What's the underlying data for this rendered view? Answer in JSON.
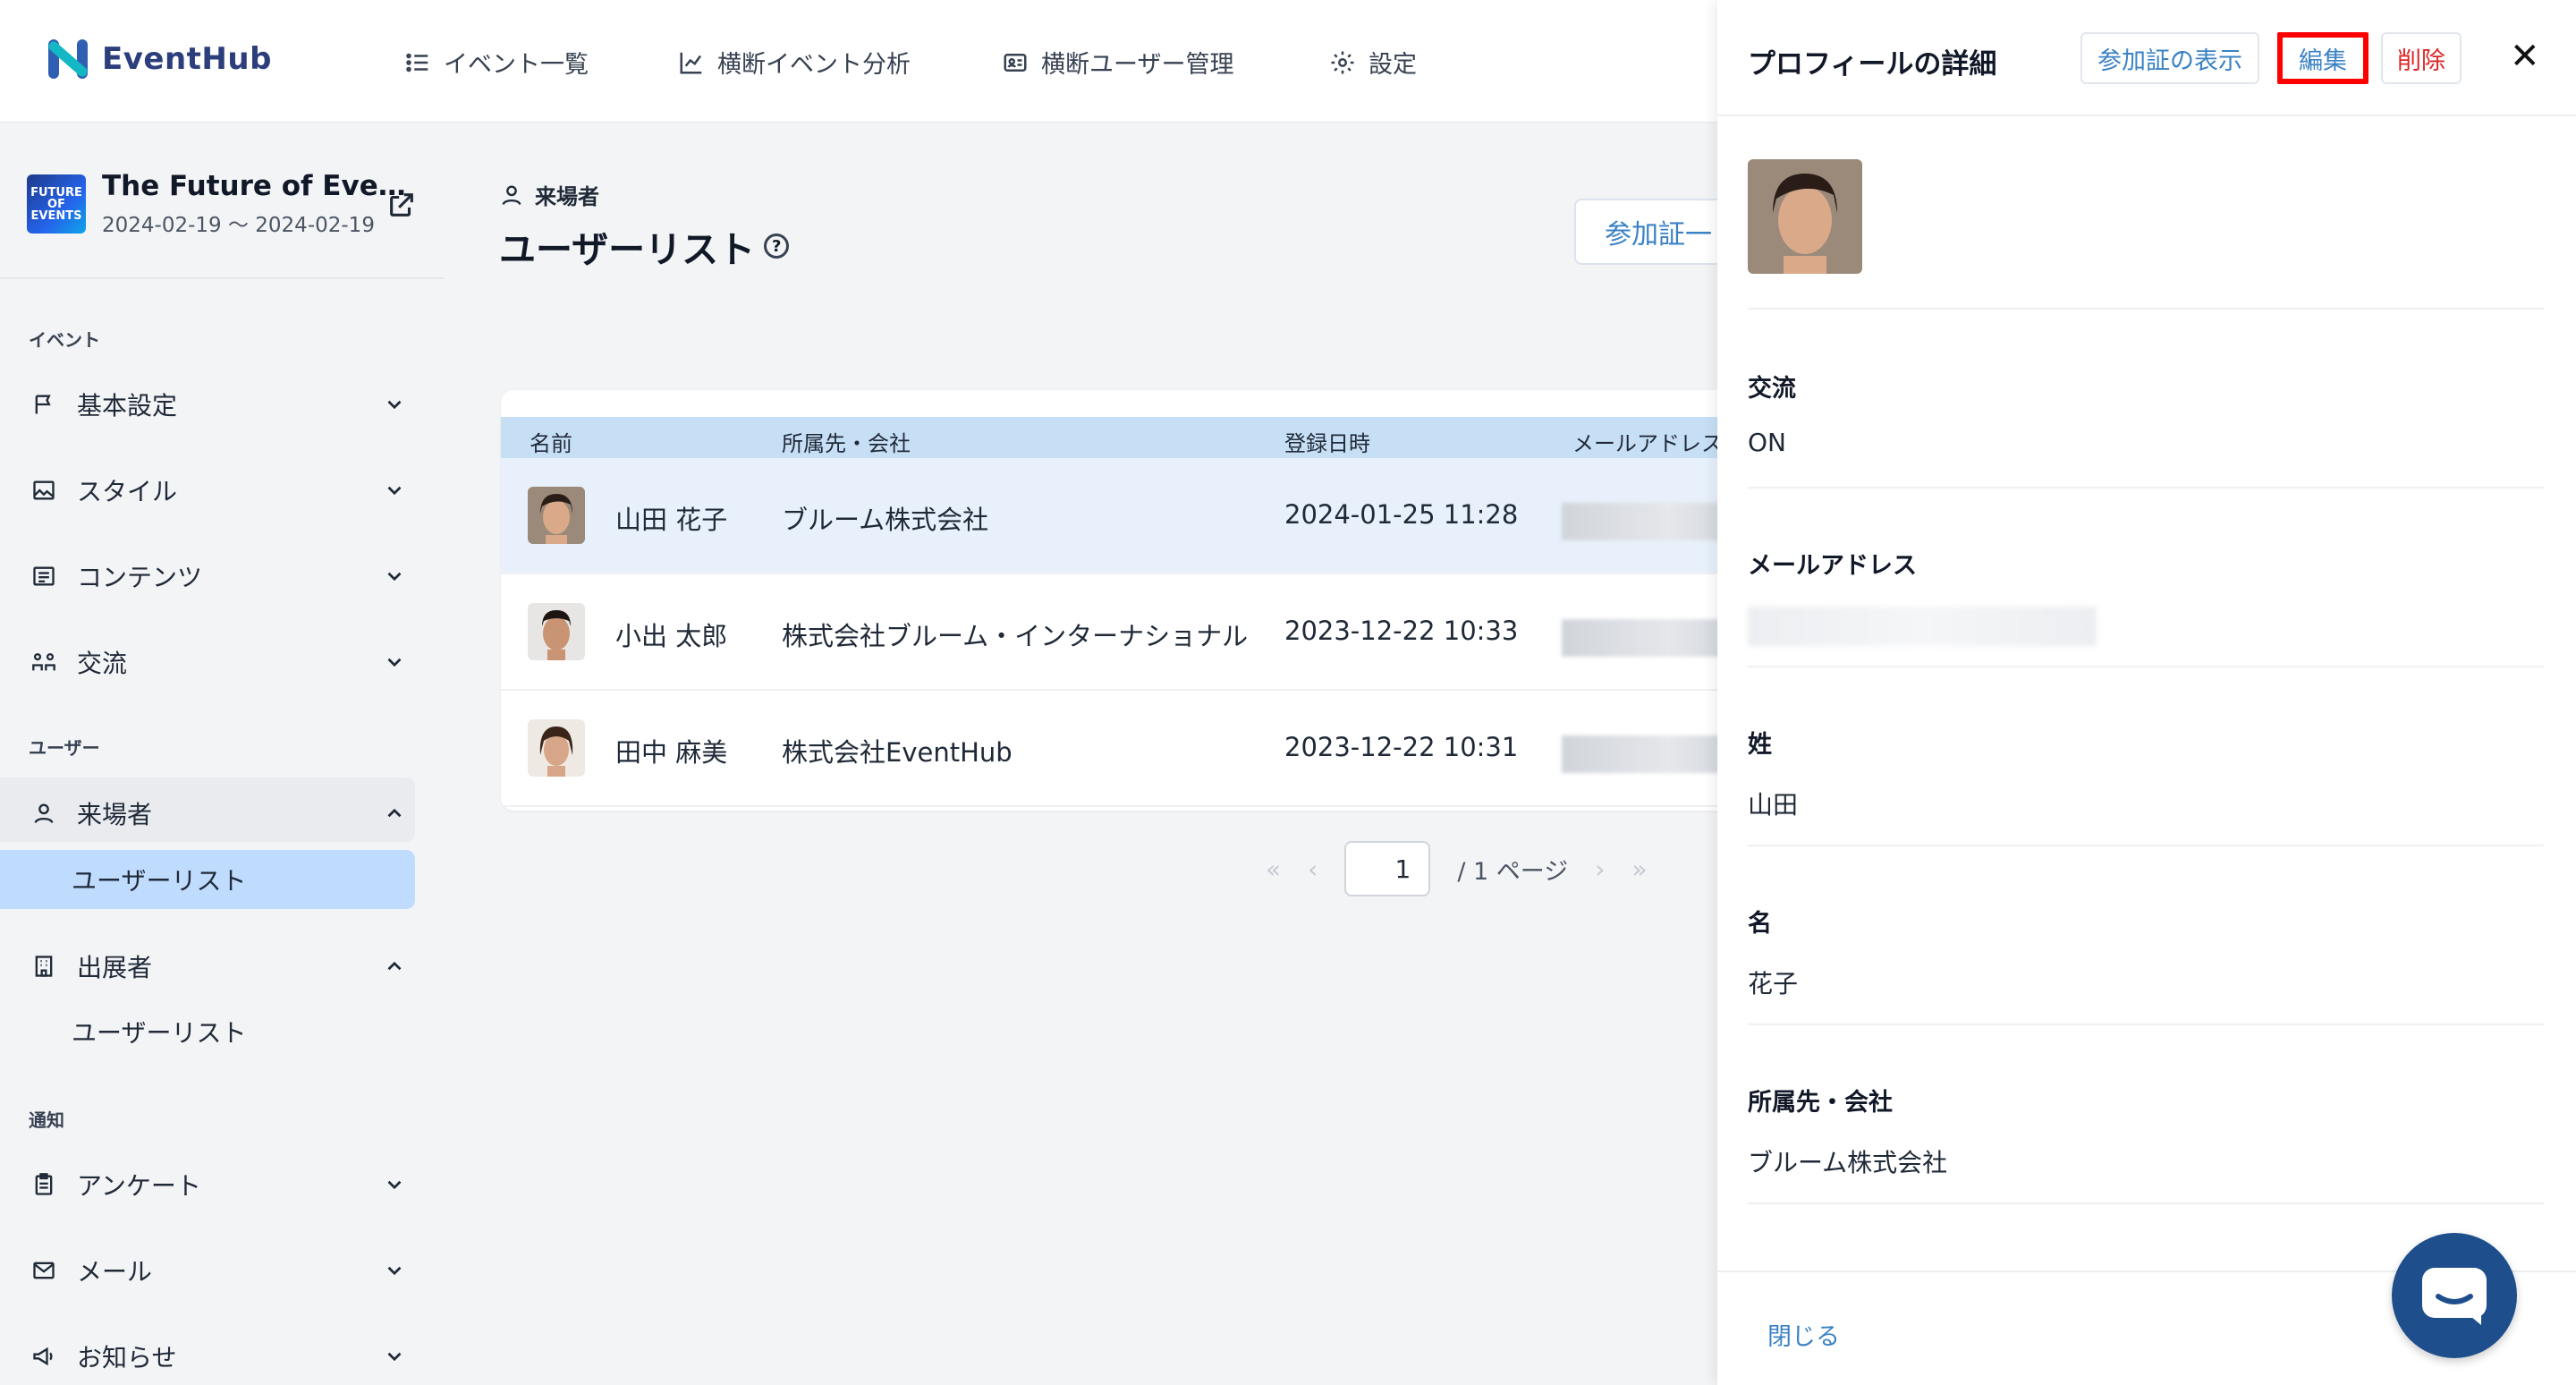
{
  "app": {
    "name": "EventHub",
    "nav": [
      "イベント一覧",
      "横断イベント分析",
      "横断ユーザー管理",
      "設定"
    ]
  },
  "event": {
    "title": "The Future of Eve…",
    "dates": "2024-02-19 〜 2024-02-19",
    "thumb_text": "FUTURE OF EVENTS"
  },
  "sidebar": {
    "section_event": "イベント",
    "section_user": "ユーザー",
    "section_notify": "通知",
    "items": {
      "basic": "基本設定",
      "style": "スタイル",
      "contents": "コンテンツ",
      "exchange": "交流",
      "visitors": "来場者",
      "visitors_userlist": "ユーザーリスト",
      "exhibitors": "出展者",
      "exhibitors_userlist": "ユーザーリスト",
      "survey": "アンケート",
      "mail": "メール",
      "news": "お知らせ"
    }
  },
  "main": {
    "breadcrumb": "来場者",
    "title": "ユーザーリスト",
    "help": "?",
    "pass_button": "参加証一",
    "columns": [
      "名前",
      "所属先・会社",
      "登録日時",
      "メールアドレス"
    ],
    "rows": [
      {
        "name": "山田 花子",
        "company": "ブルーム株式会社",
        "registered": "2024-01-25 11:28"
      },
      {
        "name": "小出 太郎",
        "company": "株式会社ブルーム・インターナショナル",
        "registered": "2023-12-22 10:33"
      },
      {
        "name": "田中 麻美",
        "company": "株式会社EventHub",
        "registered": "2023-12-22 10:31"
      }
    ],
    "pager": {
      "current": "1",
      "total_text": "/ 1 ページ"
    }
  },
  "drawer": {
    "title": "プロフィールの詳細",
    "show_pass": "参加証の表示",
    "edit": "編集",
    "delete": "削除",
    "close_x": "✕",
    "fields": [
      {
        "label": "交流",
        "value": "ON"
      },
      {
        "label": "メールアドレス",
        "value": ""
      },
      {
        "label": "姓",
        "value": "山田"
      },
      {
        "label": "名",
        "value": "花子"
      },
      {
        "label": "所属先・会社",
        "value": "ブルーム株式会社"
      }
    ],
    "close_link": "閉じる"
  },
  "colors": {
    "brand": "#2c3e7c",
    "link": "#3b82c4",
    "danger": "#dc2626",
    "highlight": "#ff0000",
    "active_menu": "#bfdbfe"
  }
}
